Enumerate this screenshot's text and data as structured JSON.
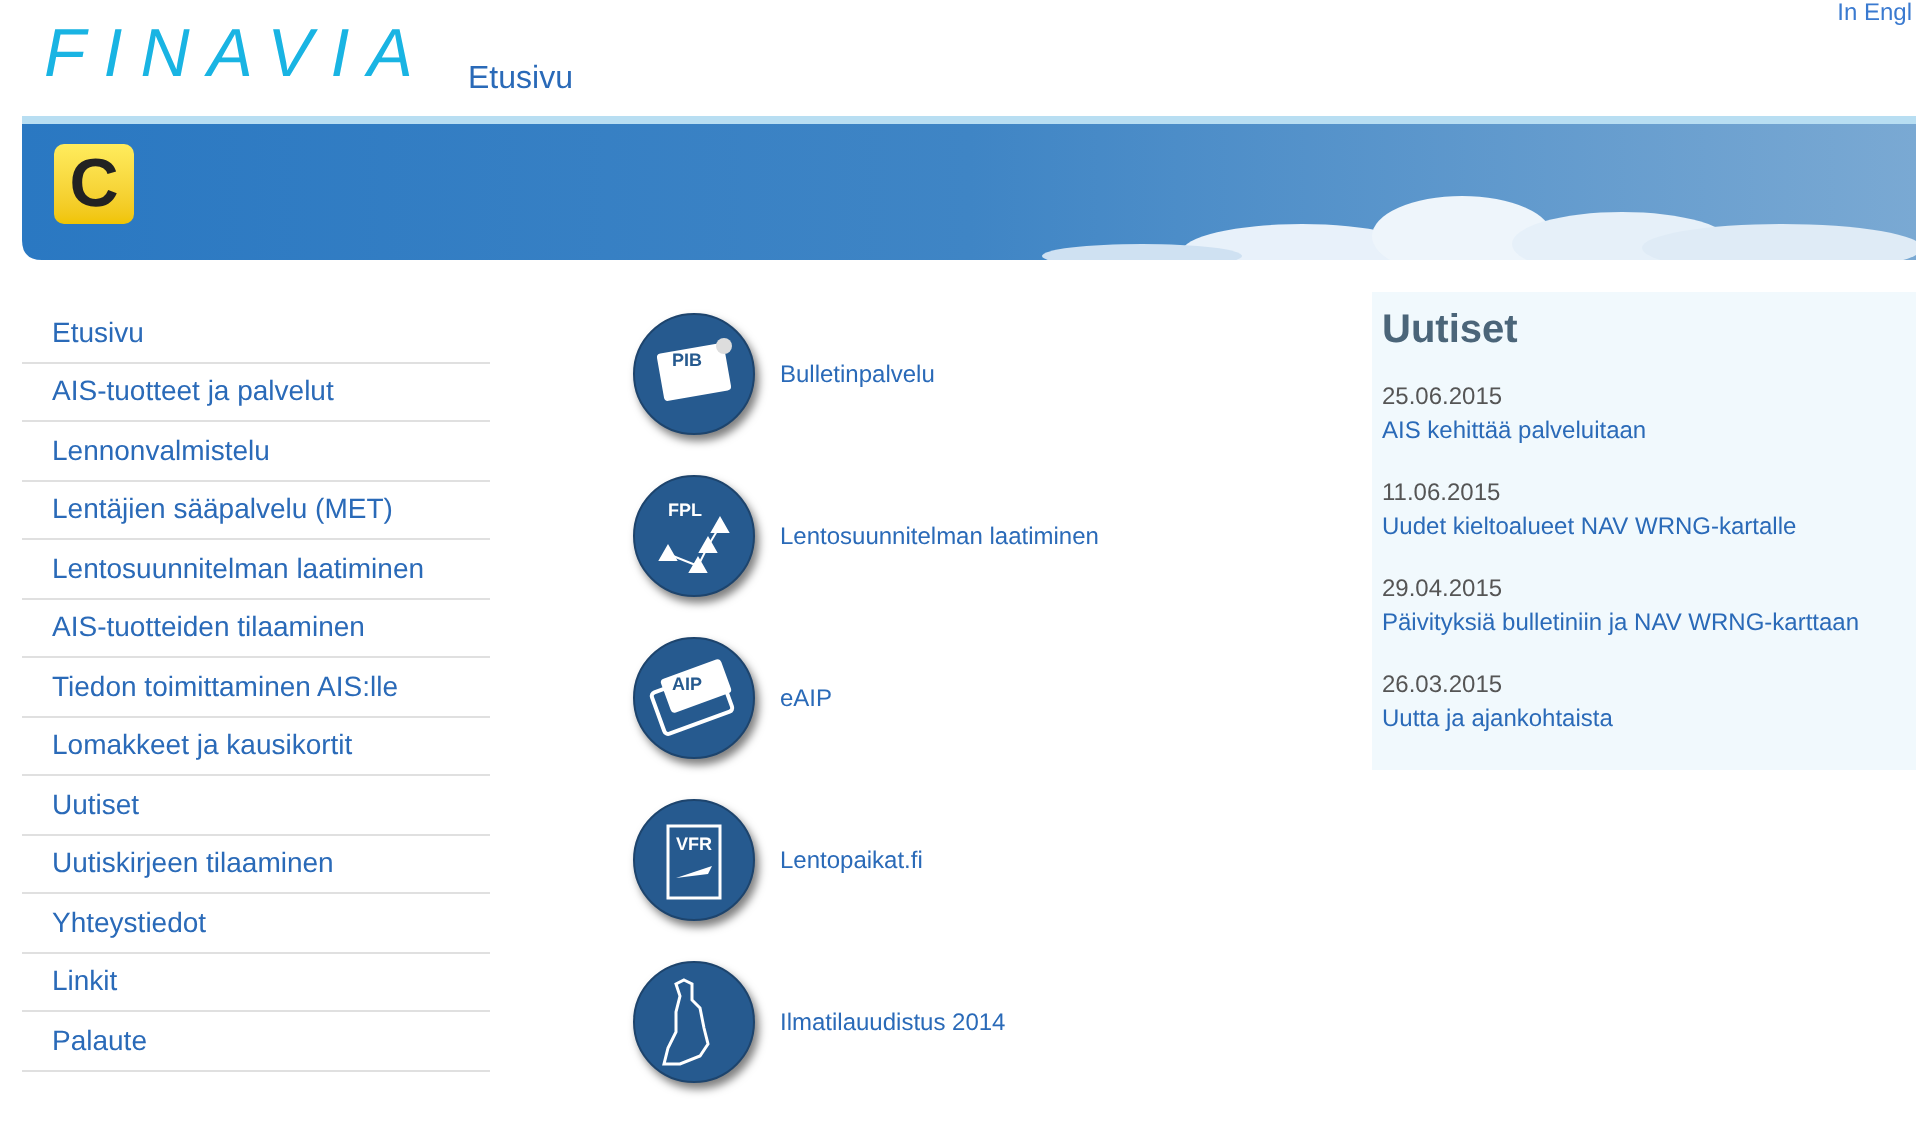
{
  "header": {
    "logo": "FINAVIA",
    "breadcrumb": "Etusivu",
    "language_link": "In Engl"
  },
  "banner": {
    "badge": "C"
  },
  "sidebar": {
    "items": [
      {
        "label": "Etusivu"
      },
      {
        "label": "AIS-tuotteet ja palvelut"
      },
      {
        "label": "Lennonvalmistelu"
      },
      {
        "label": "Lentäjien sääpalvelu (MET)"
      },
      {
        "label": "Lentosuunnitelman laatiminen"
      },
      {
        "label": "AIS-tuotteiden tilaaminen"
      },
      {
        "label": "Tiedon toimittaminen AIS:lle"
      },
      {
        "label": "Lomakkeet ja kausikortit"
      },
      {
        "label": "Uutiset"
      },
      {
        "label": "Uutiskirjeen tilaaminen"
      },
      {
        "label": "Yhteystiedot"
      },
      {
        "label": "Linkit"
      },
      {
        "label": "Palaute"
      }
    ]
  },
  "services": [
    {
      "kind": "pib",
      "icon_text": "PIB",
      "label": "Bulletinpalvelu"
    },
    {
      "kind": "fpl",
      "icon_text": "FPL",
      "label": "Lentosuunnitelman laatiminen"
    },
    {
      "kind": "aip",
      "icon_text": "AIP",
      "label": "eAIP"
    },
    {
      "kind": "vfr",
      "icon_text": "VFR",
      "label": "Lentopaikat.fi"
    },
    {
      "kind": "map",
      "label": "Ilmatilauudistus 2014"
    }
  ],
  "news": {
    "title": "Uutiset",
    "items": [
      {
        "date": "25.06.2015",
        "headline": "AIS kehittää palveluitaan"
      },
      {
        "date": "11.06.2015",
        "headline": "Uudet kieltoalueet NAV WRNG-kartalle"
      },
      {
        "date": "29.04.2015",
        "headline": "Päivityksiä bulletiniin ja NAV WRNG-karttaan"
      },
      {
        "date": "26.03.2015",
        "headline": "Uutta ja ajankohtaista"
      }
    ]
  }
}
